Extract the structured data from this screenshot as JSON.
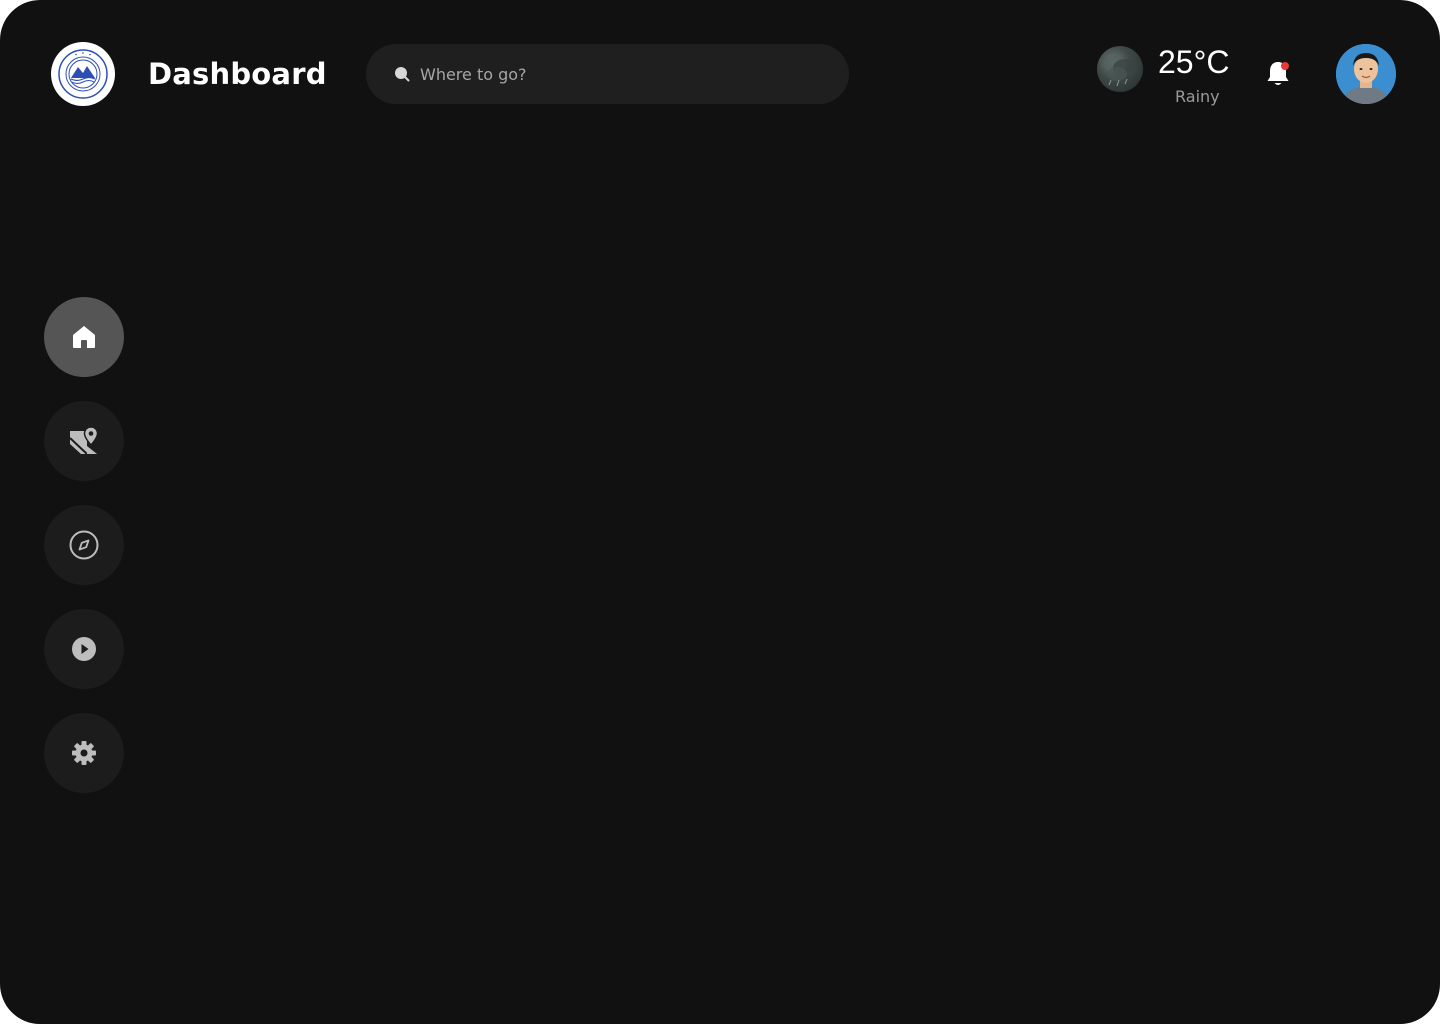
{
  "header": {
    "title": "Dashboard"
  },
  "search": {
    "placeholder": "Where to go?"
  },
  "weather": {
    "temperature": "25°C",
    "condition": "Rainy",
    "icon": "rain-cloud-icon"
  },
  "notifications": {
    "icon": "bell-icon",
    "has_unread": true,
    "badge_color": "#e53935"
  },
  "sidebar": {
    "items": [
      {
        "name": "home",
        "icon": "home-icon",
        "active": true
      },
      {
        "name": "map",
        "icon": "map-pin-icon",
        "active": false
      },
      {
        "name": "explore",
        "icon": "compass-icon",
        "active": false
      },
      {
        "name": "media",
        "icon": "play-icon",
        "active": false
      },
      {
        "name": "settings",
        "icon": "gear-icon",
        "active": false
      }
    ]
  },
  "colors": {
    "background": "#111111",
    "surface": "#1c1c1c",
    "active_nav": "#555555",
    "text_primary": "#ffffff",
    "text_secondary": "#9a9a9a"
  }
}
